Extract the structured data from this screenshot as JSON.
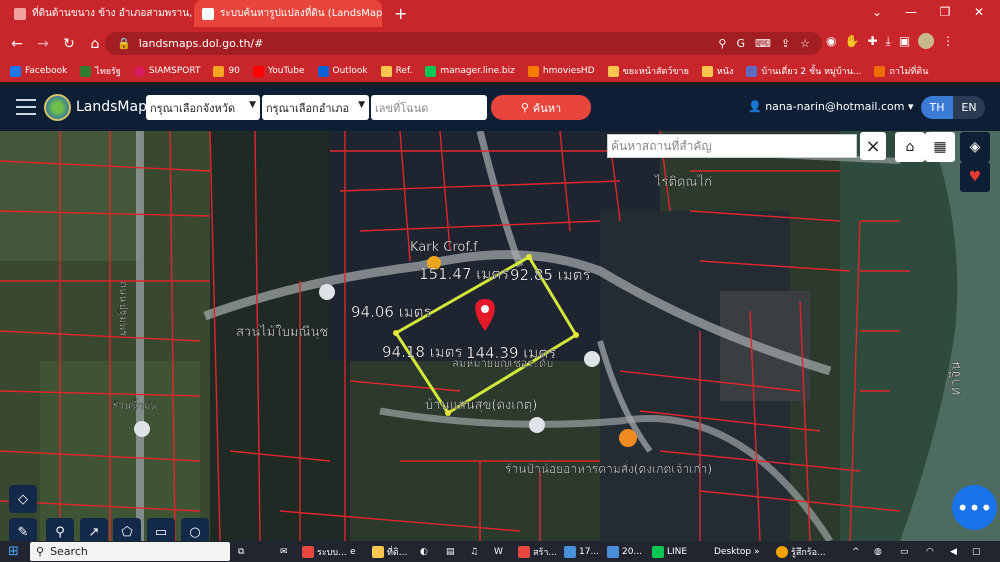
{
  "browser": {
    "tabs": [
      {
        "title": "ที่ดินด้านขนาง ข้าง อำเภอสามพราน, นเ",
        "active": false
      },
      {
        "title": "ระบบค้นหารูปแปลงที่ดิน (LandsMaps",
        "active": true
      }
    ],
    "new_tab": "+",
    "url": "landsmaps.dol.go.th/#",
    "bookmarks": [
      "Facebook",
      "ไทยรัฐ",
      "SIAMSPORT",
      "90",
      "YouTube",
      "Outlook",
      "Ref.",
      "manager.line.biz",
      "hmoviesHD",
      "ขยะหน้าสัตว์ขาย",
      "หนัง",
      "บ้านเดี่ยว 2 ชั้น หมู่บ้าน...",
      "ถาไม่ที่ดิน"
    ]
  },
  "app": {
    "brand": "LandsMaps",
    "province_select": "กรุณาเลือกจังหวัด",
    "district_select": "กรุณาเลือกอำเภอ",
    "deed_placeholder": "เลขที่โฉนด",
    "search_label": "ค้นหา",
    "user_email": "nana-narin@hotmail.com",
    "lang_th": "TH",
    "lang_en": "EN"
  },
  "map": {
    "place_search_placeholder": "ค้นหาสถานที่สำคัญ",
    "place_search_clear": "×",
    "parcel": {
      "sides": [
        {
          "label": "151.47 เมตร"
        },
        {
          "label": "92.85 เมตร"
        },
        {
          "label": "94.06 เมตร"
        },
        {
          "label": "94.18 เมตร"
        },
        {
          "label": "144.39 เมตร"
        }
      ]
    },
    "places": [
      {
        "name": "Kark Crof.f"
      },
      {
        "name": "ไร่ติดุณไก่"
      },
      {
        "name": "สวนไม้ใบมณีนุช"
      },
      {
        "name": "บ้านแสนสุข(ดงเกตุ)"
      },
      {
        "name": "ร้านน้ำมัน"
      },
      {
        "name": "ร้านป้าน้อยอาหารตามสั่ง(ดงเกตุเจ้าเก่า)"
      },
      {
        "name": "สมหมายบุญเชอระดับ"
      },
      {
        "name": "ท่าจีน"
      },
      {
        "name": "ถนนปฐมพร"
      }
    ]
  },
  "taskbar": {
    "search": "Search",
    "items": [
      "ระบบ...",
      "ที่ดิ...",
      "สร้า...",
      "17...",
      "20...",
      "LINE"
    ],
    "desktop": "Desktop",
    "weather": "รู้สึกร้อ..."
  }
}
